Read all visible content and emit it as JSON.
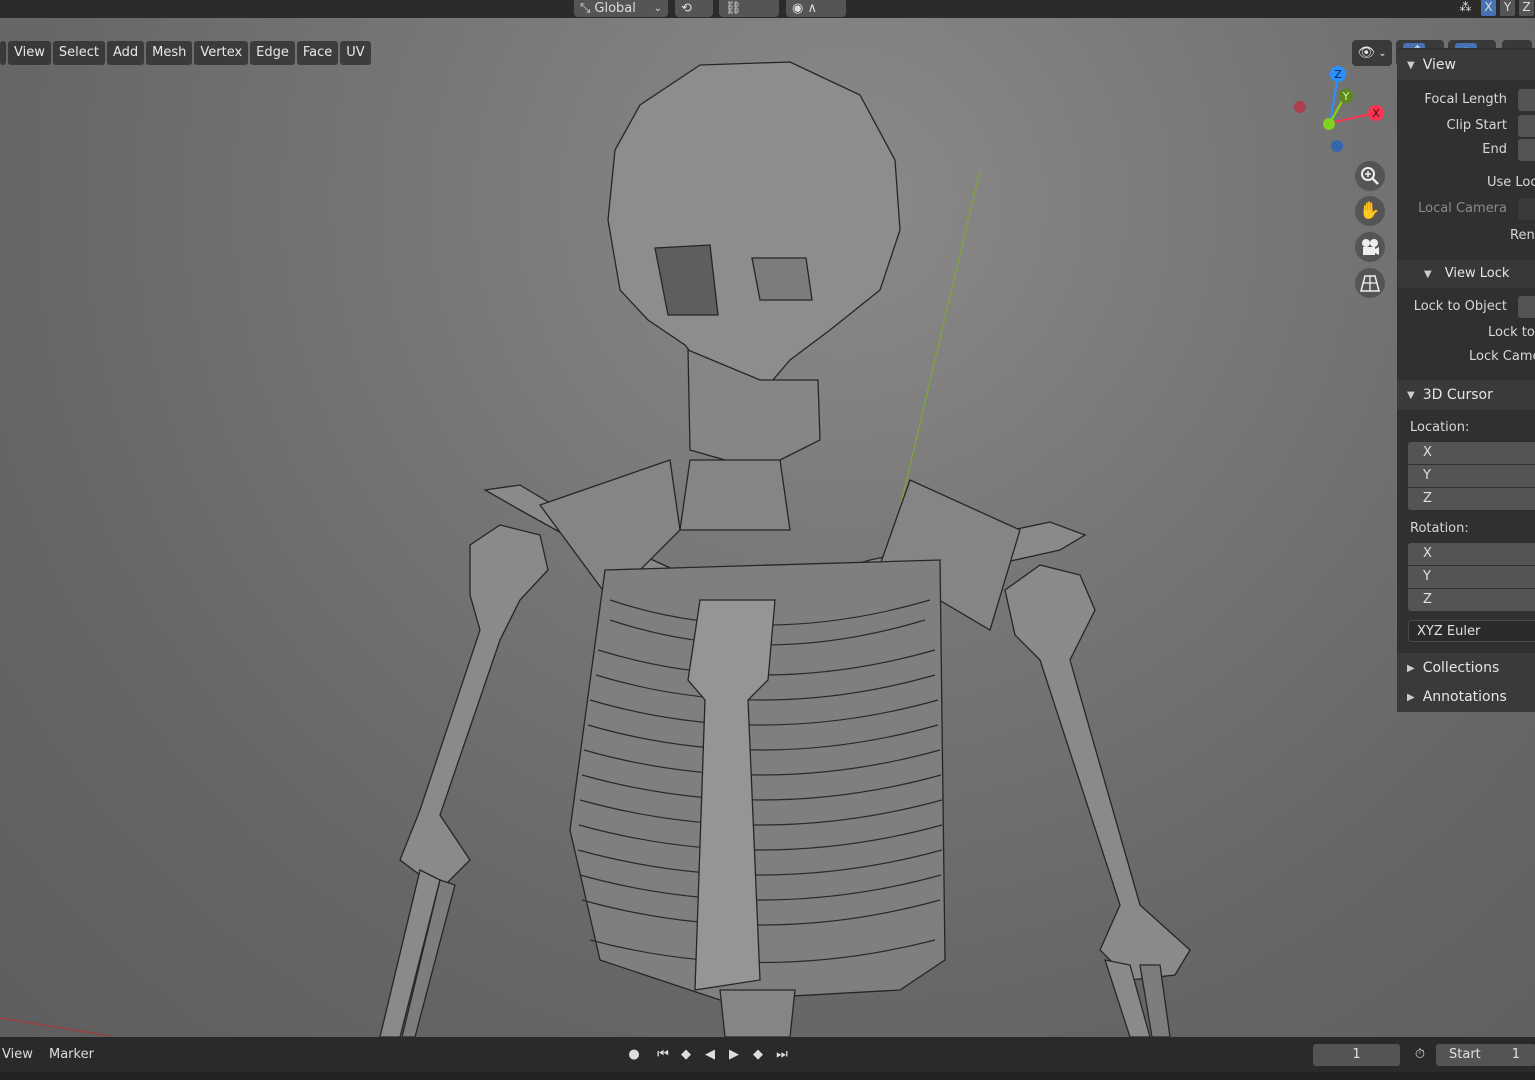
{
  "header": {
    "orientation_label": "Global",
    "axes": [
      "X",
      "Y",
      "Z"
    ]
  },
  "viewport_menu": {
    "items": [
      "View",
      "Select",
      "Add",
      "Mesh",
      "Vertex",
      "Edge",
      "Face",
      "UV"
    ]
  },
  "gizmo": {
    "axis_x": "X",
    "axis_y": "Y",
    "axis_z": "Z",
    "colors": {
      "x": "#ff3352",
      "y": "#8bdc00",
      "z": "#2890ff"
    }
  },
  "nav_icons": [
    "zoom-icon",
    "pan-hand-icon",
    "camera-view-icon",
    "perspective-grid-icon"
  ],
  "sidebar": {
    "view": {
      "title": "View",
      "focal_length_label": "Focal Length",
      "clip_start_label": "Clip Start",
      "clip_end_label": "End",
      "use_local_label": "Use Loc",
      "local_camera_label": "Local Camera",
      "render_region_label": "Ren",
      "view_lock_title": "View Lock",
      "lock_to_object_label": "Lock to Object",
      "lock_to_cursor_label": "Lock to",
      "lock_camera_label": "Lock Came"
    },
    "cursor": {
      "title": "3D Cursor",
      "location_label": "Location:",
      "location_axes": [
        "X",
        "Y",
        "Z"
      ],
      "rotation_label": "Rotation:",
      "rotation_axes": [
        "X",
        "Y",
        "Z"
      ],
      "rotation_mode": "XYZ Euler"
    },
    "collections_title": "Collections",
    "annotations_title": "Annotations"
  },
  "timeline": {
    "view_label": "View",
    "marker_label": "Marker",
    "current_frame": "1",
    "start_label": "Start",
    "start_value": "1"
  }
}
